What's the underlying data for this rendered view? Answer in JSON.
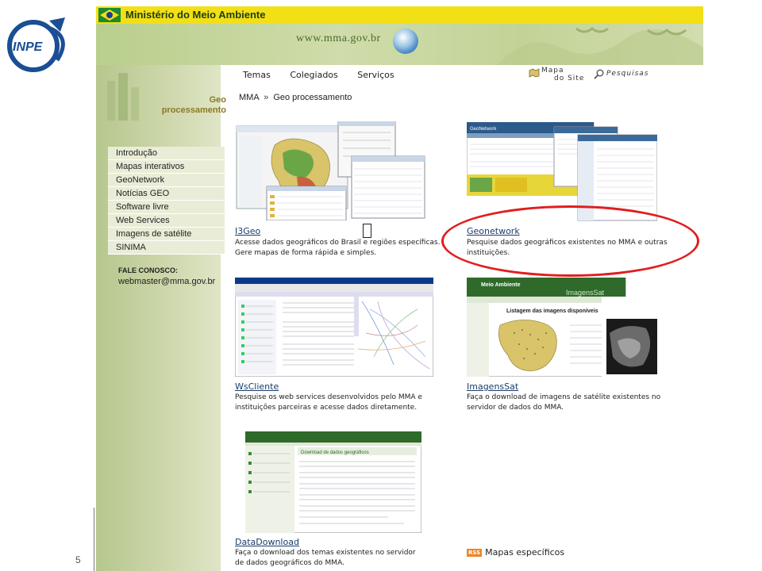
{
  "slide": {
    "page_number": "5"
  },
  "logo": {
    "text": "INPE"
  },
  "header": {
    "ministry_name": "Ministério do Meio Ambiente",
    "url": "www.mma.gov.br"
  },
  "sidebar": {
    "section_title_line1": "Geo",
    "section_title_line2": "processamento",
    "items": [
      {
        "label": "Introdução"
      },
      {
        "label": "Mapas interativos"
      },
      {
        "label": "GeoNetwork"
      },
      {
        "label": "Notícias GEO"
      },
      {
        "label": "Software livre"
      },
      {
        "label": "Web Services"
      },
      {
        "label": "Imagens de satélite"
      },
      {
        "label": "SINIMA"
      }
    ],
    "contact_label": "FALE CONOSCO:",
    "contact_email": "webmaster@mma.gov.br"
  },
  "topnav": {
    "items": [
      {
        "label": "Temas"
      },
      {
        "label": "Colegiados"
      },
      {
        "label": "Serviços"
      }
    ],
    "sitemap_line1": "Mapa",
    "sitemap_line2": "do Site",
    "search_label": "Pesquisas"
  },
  "breadcrumb": {
    "root": "MMA",
    "separator": "»",
    "current": "Geo processamento"
  },
  "cards": [
    {
      "title": "I3Geo",
      "desc_line1": "Acesse dados geográficos do Brasil e regiões específicas.",
      "desc_line2": "Gere mapas de forma rápida e simples."
    },
    {
      "title": "Geonetwork",
      "desc_line1": "Pesquise dados geográficos existentes no MMA e outras",
      "desc_line2": "instituições."
    },
    {
      "title": "WsCliente",
      "desc_line1": "Pesquise os web services desenvolvidos pelo MMA e",
      "desc_line2": "instituições parceiras e acesse dados diretamente."
    },
    {
      "title": "ImagensSat",
      "desc_line1": "Faça o download de imagens de satélite existentes no",
      "desc_line2": "servidor de dados do MMA."
    },
    {
      "title": "DataDownload",
      "desc_line1": "Faça o download dos temas existentes no servidor",
      "desc_line2": "de dados geográficos do MMA."
    }
  ],
  "thumbnails": {
    "geonetwork_header": "GeoNetwork",
    "imagens_brand": "Meio Ambiente",
    "imagens_list_title": "Listagem das imagens disponíveis",
    "imagens_subtitle": "ImagensSat",
    "datadownload_heading": "Download de dados geográficos"
  },
  "rss": {
    "badge": "RSS",
    "label": "Mapas específicos"
  },
  "colors": {
    "gov_bar": "#f2df16",
    "banner_green": "#c3d397",
    "link_blue": "#1a3d6b",
    "highlight_red": "#e21d1d",
    "rss_orange": "#f08221"
  },
  "icons": [
    "inpe-logo",
    "brazil-flag-icon",
    "globe-icon",
    "map-icon",
    "magnifier-icon",
    "rss-icon",
    "cursor-icon"
  ]
}
